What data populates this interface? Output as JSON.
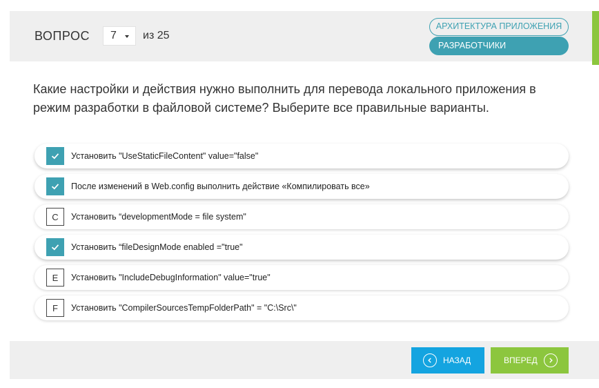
{
  "header": {
    "question_label": "ВОПРОС",
    "current_question": "7",
    "total": "из 25",
    "tag_outline": "АРХИТЕКТУРА ПРИЛОЖЕНИЯ",
    "tag_filled": "РАЗРАБОТЧИКИ"
  },
  "question": {
    "text": "Какие настройки и действия нужно выполнить для перевода локального приложения в режим разработки в файловой системе? Выберите все правильные варианты."
  },
  "options": [
    {
      "marker": "",
      "checked": true,
      "text": "Установить \"UseStaticFileContent\" value=\"false\""
    },
    {
      "marker": "",
      "checked": true,
      "text": "После изменений в Web.config выполнить действие «Компилировать все»"
    },
    {
      "marker": "C",
      "checked": false,
      "text": "Установить “developmentMode = file system\""
    },
    {
      "marker": "",
      "checked": true,
      "text": "Установить “fileDesignMode enabled =\"true\""
    },
    {
      "marker": "E",
      "checked": false,
      "text": "Установить \"IncludeDebugInformation\" value=\"true\""
    },
    {
      "marker": "F",
      "checked": false,
      "text": "Установить \"CompilerSourcesTempFolderPath\" = \"C:\\Src\\\""
    }
  ],
  "footer": {
    "back_label": "НАЗАД",
    "next_label": "ВПЕРЕД"
  },
  "colors": {
    "accent": "#3ea1b2",
    "back_button": "#14a4e0",
    "next_button": "#8cc63e"
  }
}
